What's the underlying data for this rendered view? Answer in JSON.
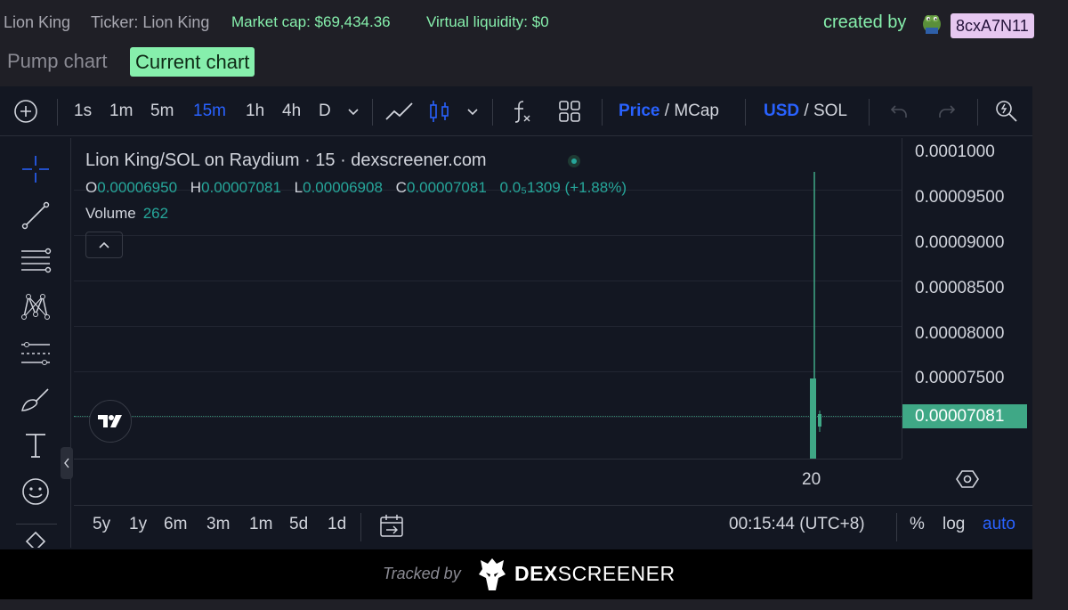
{
  "header": {
    "name": "Lion King",
    "ticker": "Ticker: Lion King",
    "market_cap": "Market cap: $69,434.36",
    "virtual_liquidity": "Virtual liquidity: $0",
    "created_by": "created by",
    "creator": "8cxA7N11"
  },
  "tabs": {
    "pump": "Pump chart",
    "current": "Current chart"
  },
  "toolbar": {
    "intervals": [
      "1s",
      "1m",
      "5m",
      "15m",
      "1h",
      "4h",
      "D"
    ],
    "active_interval": "15m",
    "price": "Price",
    "mcap": " / MCap",
    "usd": "USD",
    "sol": " / SOL"
  },
  "legend": {
    "title": "Lion King/SOL on Raydium · 15 · dexscreener.com",
    "o_key": "O",
    "o": "0.00006950",
    "h_key": "H",
    "h": "0.00007081",
    "l_key": "L",
    "l": "0.00006908",
    "c_key": "C",
    "c": "0.00007081",
    "change": "0.0₅1309 (+1.88%)",
    "volume_label": "Volume",
    "volume": "262"
  },
  "yaxis": {
    "ticks": [
      "0.0001000",
      "0.00009500",
      "0.00009000",
      "0.00008500",
      "0.00008000",
      "0.00007500"
    ],
    "current_price": "0.00007081"
  },
  "xaxis": {
    "label": "20"
  },
  "bottom": {
    "ranges": [
      "5y",
      "1y",
      "6m",
      "3m",
      "1m",
      "5d",
      "1d"
    ],
    "time": "00:15:44 (UTC+8)",
    "percent": "%",
    "log": "log",
    "auto": "auto"
  },
  "footer": {
    "tracked_by": "Tracked by",
    "brand_dex": "DEX",
    "brand_screener": "SCREENER"
  },
  "colors": {
    "accent_green": "#86efac",
    "candle_up": "#26a69a",
    "active_blue": "#2962ff",
    "creator_badge": "#e6c7f0"
  }
}
